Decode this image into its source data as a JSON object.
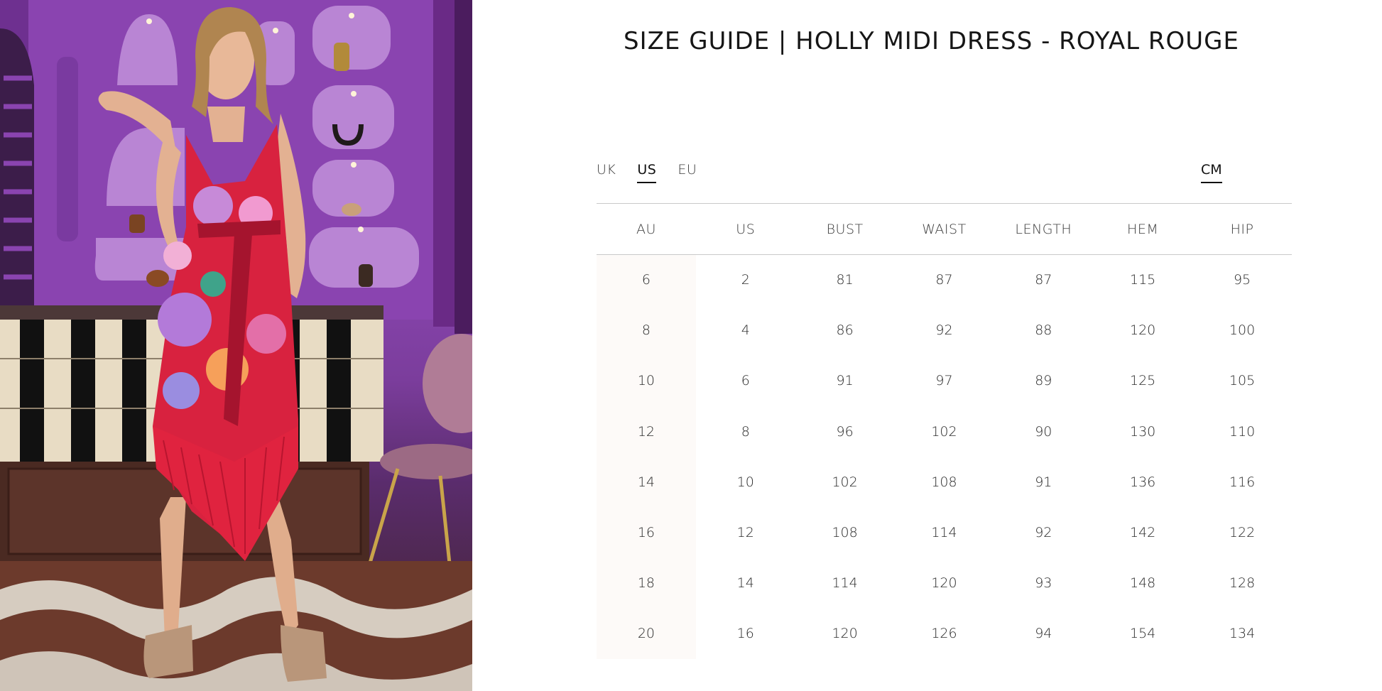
{
  "page": {
    "title": "SIZE GUIDE | HOLLY MIDI DRESS - ROYAL ROUGE"
  },
  "region_tabs": [
    {
      "label": "UK",
      "active": false
    },
    {
      "label": "US",
      "active": true
    },
    {
      "label": "EU",
      "active": false
    }
  ],
  "unit_tab": {
    "label": "CM",
    "active": true
  },
  "table": {
    "headers": [
      "AU",
      "US",
      "BUST",
      "WAIST",
      "LENGTH",
      "HEM",
      "HIP"
    ],
    "rows": [
      [
        "6",
        "2",
        "81",
        "87",
        "87",
        "115",
        "95"
      ],
      [
        "8",
        "4",
        "86",
        "92",
        "88",
        "120",
        "100"
      ],
      [
        "10",
        "6",
        "91",
        "97",
        "89",
        "125",
        "105"
      ],
      [
        "12",
        "8",
        "96",
        "102",
        "90",
        "130",
        "110"
      ],
      [
        "14",
        "10",
        "102",
        "108",
        "91",
        "136",
        "116"
      ],
      [
        "16",
        "12",
        "108",
        "114",
        "92",
        "142",
        "122"
      ],
      [
        "18",
        "14",
        "114",
        "120",
        "93",
        "148",
        "128"
      ],
      [
        "20",
        "16",
        "120",
        "126",
        "94",
        "154",
        "134"
      ]
    ]
  },
  "colors": {
    "photo_wall": "#8c47b3",
    "dress": "#d8223f",
    "text": "#1c1c1c",
    "rule": "#c9c9c9"
  }
}
